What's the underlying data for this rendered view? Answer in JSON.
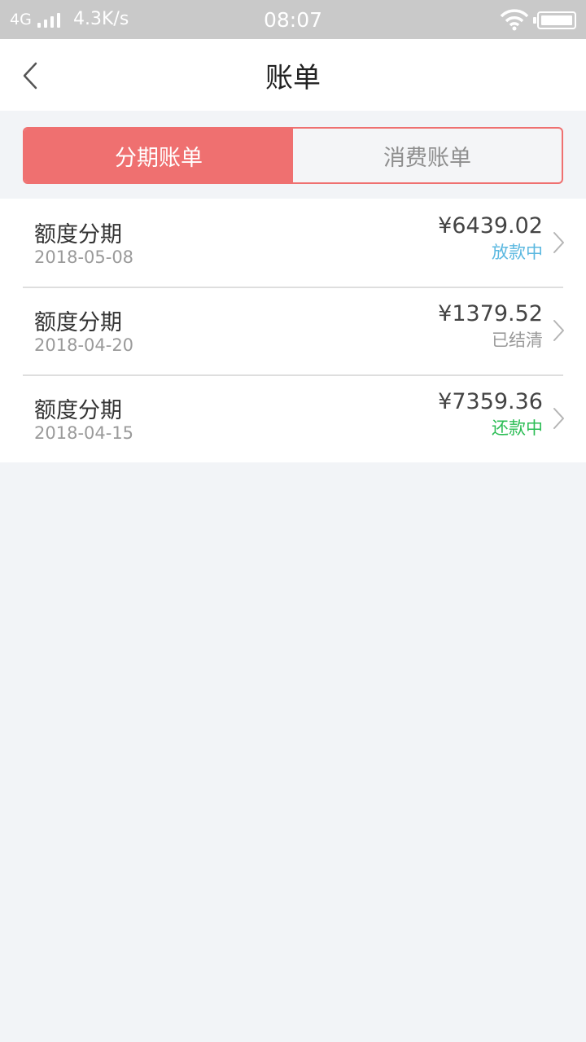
{
  "status_bar": {
    "network": "4G",
    "speed": "4.3K/s",
    "time": "08:07"
  },
  "nav": {
    "title": "账单"
  },
  "tabs": [
    {
      "label": "分期账单",
      "active": true
    },
    {
      "label": "消费账单",
      "active": false
    }
  ],
  "bills": [
    {
      "title": "额度分期",
      "date": "2018-05-08",
      "amount": "¥6439.02",
      "status": "放款中",
      "status_color": "#5bb8e0"
    },
    {
      "title": "额度分期",
      "date": "2018-04-20",
      "amount": "¥1379.52",
      "status": "已结清",
      "status_color": "#9a9a9a"
    },
    {
      "title": "额度分期",
      "date": "2018-04-15",
      "amount": "¥7359.36",
      "status": "还款中",
      "status_color": "#2cbd55"
    }
  ],
  "icons": {
    "back": "chevron-left-icon",
    "row_arrow": "chevron-right-icon",
    "wifi": "wifi-icon",
    "battery": "battery-icon",
    "signal": "signal-icon"
  },
  "colors": {
    "accent": "#ef7070",
    "background": "#f2f4f7"
  }
}
